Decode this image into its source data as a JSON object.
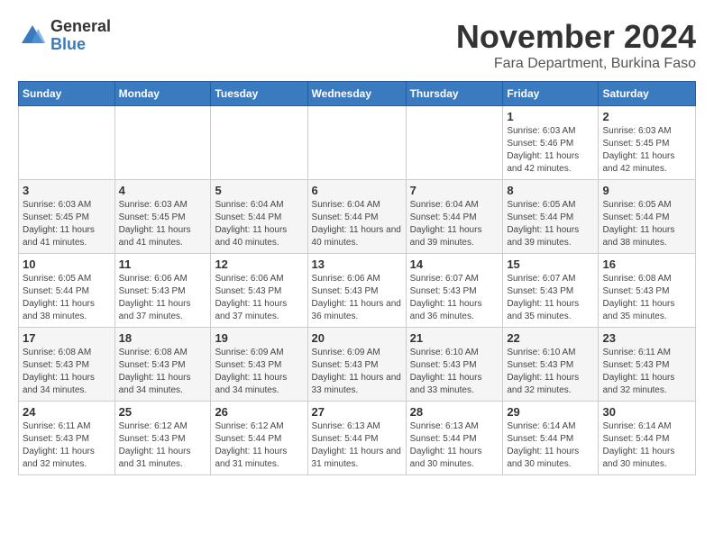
{
  "logo": {
    "general": "General",
    "blue": "Blue"
  },
  "title": {
    "month": "November 2024",
    "location": "Fara Department, Burkina Faso"
  },
  "weekdays": [
    "Sunday",
    "Monday",
    "Tuesday",
    "Wednesday",
    "Thursday",
    "Friday",
    "Saturday"
  ],
  "weeks": [
    [
      {
        "day": "",
        "info": ""
      },
      {
        "day": "",
        "info": ""
      },
      {
        "day": "",
        "info": ""
      },
      {
        "day": "",
        "info": ""
      },
      {
        "day": "",
        "info": ""
      },
      {
        "day": "1",
        "info": "Sunrise: 6:03 AM\nSunset: 5:46 PM\nDaylight: 11 hours and 42 minutes."
      },
      {
        "day": "2",
        "info": "Sunrise: 6:03 AM\nSunset: 5:45 PM\nDaylight: 11 hours and 42 minutes."
      }
    ],
    [
      {
        "day": "3",
        "info": "Sunrise: 6:03 AM\nSunset: 5:45 PM\nDaylight: 11 hours and 41 minutes."
      },
      {
        "day": "4",
        "info": "Sunrise: 6:03 AM\nSunset: 5:45 PM\nDaylight: 11 hours and 41 minutes."
      },
      {
        "day": "5",
        "info": "Sunrise: 6:04 AM\nSunset: 5:44 PM\nDaylight: 11 hours and 40 minutes."
      },
      {
        "day": "6",
        "info": "Sunrise: 6:04 AM\nSunset: 5:44 PM\nDaylight: 11 hours and 40 minutes."
      },
      {
        "day": "7",
        "info": "Sunrise: 6:04 AM\nSunset: 5:44 PM\nDaylight: 11 hours and 39 minutes."
      },
      {
        "day": "8",
        "info": "Sunrise: 6:05 AM\nSunset: 5:44 PM\nDaylight: 11 hours and 39 minutes."
      },
      {
        "day": "9",
        "info": "Sunrise: 6:05 AM\nSunset: 5:44 PM\nDaylight: 11 hours and 38 minutes."
      }
    ],
    [
      {
        "day": "10",
        "info": "Sunrise: 6:05 AM\nSunset: 5:44 PM\nDaylight: 11 hours and 38 minutes."
      },
      {
        "day": "11",
        "info": "Sunrise: 6:06 AM\nSunset: 5:43 PM\nDaylight: 11 hours and 37 minutes."
      },
      {
        "day": "12",
        "info": "Sunrise: 6:06 AM\nSunset: 5:43 PM\nDaylight: 11 hours and 37 minutes."
      },
      {
        "day": "13",
        "info": "Sunrise: 6:06 AM\nSunset: 5:43 PM\nDaylight: 11 hours and 36 minutes."
      },
      {
        "day": "14",
        "info": "Sunrise: 6:07 AM\nSunset: 5:43 PM\nDaylight: 11 hours and 36 minutes."
      },
      {
        "day": "15",
        "info": "Sunrise: 6:07 AM\nSunset: 5:43 PM\nDaylight: 11 hours and 35 minutes."
      },
      {
        "day": "16",
        "info": "Sunrise: 6:08 AM\nSunset: 5:43 PM\nDaylight: 11 hours and 35 minutes."
      }
    ],
    [
      {
        "day": "17",
        "info": "Sunrise: 6:08 AM\nSunset: 5:43 PM\nDaylight: 11 hours and 34 minutes."
      },
      {
        "day": "18",
        "info": "Sunrise: 6:08 AM\nSunset: 5:43 PM\nDaylight: 11 hours and 34 minutes."
      },
      {
        "day": "19",
        "info": "Sunrise: 6:09 AM\nSunset: 5:43 PM\nDaylight: 11 hours and 34 minutes."
      },
      {
        "day": "20",
        "info": "Sunrise: 6:09 AM\nSunset: 5:43 PM\nDaylight: 11 hours and 33 minutes."
      },
      {
        "day": "21",
        "info": "Sunrise: 6:10 AM\nSunset: 5:43 PM\nDaylight: 11 hours and 33 minutes."
      },
      {
        "day": "22",
        "info": "Sunrise: 6:10 AM\nSunset: 5:43 PM\nDaylight: 11 hours and 32 minutes."
      },
      {
        "day": "23",
        "info": "Sunrise: 6:11 AM\nSunset: 5:43 PM\nDaylight: 11 hours and 32 minutes."
      }
    ],
    [
      {
        "day": "24",
        "info": "Sunrise: 6:11 AM\nSunset: 5:43 PM\nDaylight: 11 hours and 32 minutes."
      },
      {
        "day": "25",
        "info": "Sunrise: 6:12 AM\nSunset: 5:43 PM\nDaylight: 11 hours and 31 minutes."
      },
      {
        "day": "26",
        "info": "Sunrise: 6:12 AM\nSunset: 5:44 PM\nDaylight: 11 hours and 31 minutes."
      },
      {
        "day": "27",
        "info": "Sunrise: 6:13 AM\nSunset: 5:44 PM\nDaylight: 11 hours and 31 minutes."
      },
      {
        "day": "28",
        "info": "Sunrise: 6:13 AM\nSunset: 5:44 PM\nDaylight: 11 hours and 30 minutes."
      },
      {
        "day": "29",
        "info": "Sunrise: 6:14 AM\nSunset: 5:44 PM\nDaylight: 11 hours and 30 minutes."
      },
      {
        "day": "30",
        "info": "Sunrise: 6:14 AM\nSunset: 5:44 PM\nDaylight: 11 hours and 30 minutes."
      }
    ]
  ]
}
